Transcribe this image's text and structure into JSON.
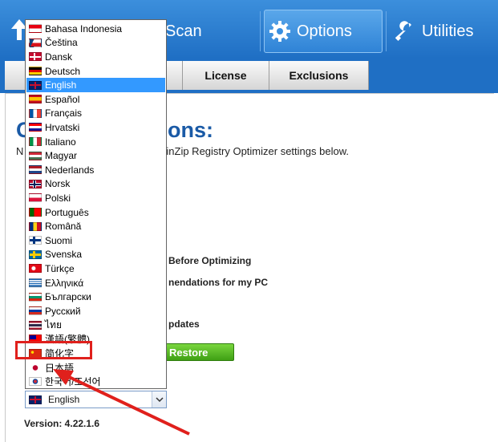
{
  "toolbar": {
    "scan_label": "Scan",
    "options_label": "Options",
    "utilities_label": "Utilities"
  },
  "subtabs": {
    "license_label": "License",
    "exclusions_label": "Exclusions"
  },
  "main": {
    "title_fragment": "ons:",
    "title_prefix": "O",
    "description": "inZip Registry Optimizer settings below.",
    "description_prefix": "N",
    "option_before_optimizing": "Before Optimizing",
    "option_recommendations": "nendations for my PC",
    "option_updates": "pdates",
    "restore_button": "Restore",
    "version": "Version: 4.22.1.6"
  },
  "language_select": {
    "selected": "English",
    "options": [
      "Bahasa Indonesia",
      "Čeština",
      "Dansk",
      "Deutsch",
      "English",
      "Español",
      "Français",
      "Hrvatski",
      "Italiano",
      "Magyar",
      "Nederlands",
      "Norsk",
      "Polski",
      "Português",
      "Română",
      "Suomi",
      "Svenska",
      "Türkçe",
      "Ελληνικά",
      "Български",
      "Русский",
      "ไทย",
      "漢語(繁體)",
      "简化字",
      "日本語",
      "한국어/조선어"
    ]
  },
  "colors": {
    "toolbar_blue": "#2a7fd4",
    "selection_blue": "#3399ff",
    "annotation_red": "#e0201c",
    "restore_green": "#4cae1c"
  },
  "icons": {
    "options": "gear-icon",
    "utilities": "wrench-icon",
    "back": "arrow-up-icon",
    "combo": "chevron-down-icon"
  }
}
